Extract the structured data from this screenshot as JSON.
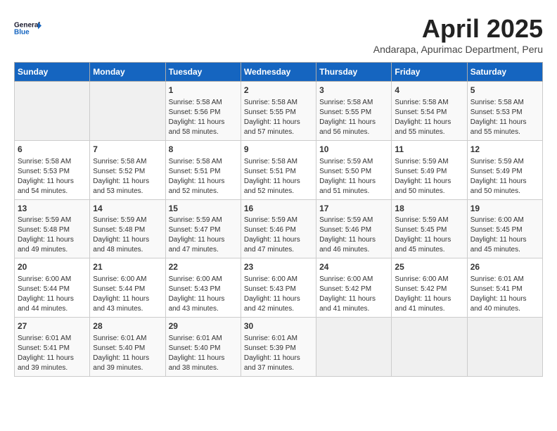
{
  "header": {
    "logo_general": "General",
    "logo_blue": "Blue",
    "month": "April 2025",
    "location": "Andarapa, Apurimac Department, Peru"
  },
  "columns": [
    "Sunday",
    "Monday",
    "Tuesday",
    "Wednesday",
    "Thursday",
    "Friday",
    "Saturday"
  ],
  "weeks": [
    [
      {
        "day": "",
        "info": ""
      },
      {
        "day": "",
        "info": ""
      },
      {
        "day": "1",
        "info": "Sunrise: 5:58 AM\nSunset: 5:56 PM\nDaylight: 11 hours and 58 minutes."
      },
      {
        "day": "2",
        "info": "Sunrise: 5:58 AM\nSunset: 5:55 PM\nDaylight: 11 hours and 57 minutes."
      },
      {
        "day": "3",
        "info": "Sunrise: 5:58 AM\nSunset: 5:55 PM\nDaylight: 11 hours and 56 minutes."
      },
      {
        "day": "4",
        "info": "Sunrise: 5:58 AM\nSunset: 5:54 PM\nDaylight: 11 hours and 55 minutes."
      },
      {
        "day": "5",
        "info": "Sunrise: 5:58 AM\nSunset: 5:53 PM\nDaylight: 11 hours and 55 minutes."
      }
    ],
    [
      {
        "day": "6",
        "info": "Sunrise: 5:58 AM\nSunset: 5:53 PM\nDaylight: 11 hours and 54 minutes."
      },
      {
        "day": "7",
        "info": "Sunrise: 5:58 AM\nSunset: 5:52 PM\nDaylight: 11 hours and 53 minutes."
      },
      {
        "day": "8",
        "info": "Sunrise: 5:58 AM\nSunset: 5:51 PM\nDaylight: 11 hours and 52 minutes."
      },
      {
        "day": "9",
        "info": "Sunrise: 5:58 AM\nSunset: 5:51 PM\nDaylight: 11 hours and 52 minutes."
      },
      {
        "day": "10",
        "info": "Sunrise: 5:59 AM\nSunset: 5:50 PM\nDaylight: 11 hours and 51 minutes."
      },
      {
        "day": "11",
        "info": "Sunrise: 5:59 AM\nSunset: 5:49 PM\nDaylight: 11 hours and 50 minutes."
      },
      {
        "day": "12",
        "info": "Sunrise: 5:59 AM\nSunset: 5:49 PM\nDaylight: 11 hours and 50 minutes."
      }
    ],
    [
      {
        "day": "13",
        "info": "Sunrise: 5:59 AM\nSunset: 5:48 PM\nDaylight: 11 hours and 49 minutes."
      },
      {
        "day": "14",
        "info": "Sunrise: 5:59 AM\nSunset: 5:48 PM\nDaylight: 11 hours and 48 minutes."
      },
      {
        "day": "15",
        "info": "Sunrise: 5:59 AM\nSunset: 5:47 PM\nDaylight: 11 hours and 47 minutes."
      },
      {
        "day": "16",
        "info": "Sunrise: 5:59 AM\nSunset: 5:46 PM\nDaylight: 11 hours and 47 minutes."
      },
      {
        "day": "17",
        "info": "Sunrise: 5:59 AM\nSunset: 5:46 PM\nDaylight: 11 hours and 46 minutes."
      },
      {
        "day": "18",
        "info": "Sunrise: 5:59 AM\nSunset: 5:45 PM\nDaylight: 11 hours and 45 minutes."
      },
      {
        "day": "19",
        "info": "Sunrise: 6:00 AM\nSunset: 5:45 PM\nDaylight: 11 hours and 45 minutes."
      }
    ],
    [
      {
        "day": "20",
        "info": "Sunrise: 6:00 AM\nSunset: 5:44 PM\nDaylight: 11 hours and 44 minutes."
      },
      {
        "day": "21",
        "info": "Sunrise: 6:00 AM\nSunset: 5:44 PM\nDaylight: 11 hours and 43 minutes."
      },
      {
        "day": "22",
        "info": "Sunrise: 6:00 AM\nSunset: 5:43 PM\nDaylight: 11 hours and 43 minutes."
      },
      {
        "day": "23",
        "info": "Sunrise: 6:00 AM\nSunset: 5:43 PM\nDaylight: 11 hours and 42 minutes."
      },
      {
        "day": "24",
        "info": "Sunrise: 6:00 AM\nSunset: 5:42 PM\nDaylight: 11 hours and 41 minutes."
      },
      {
        "day": "25",
        "info": "Sunrise: 6:00 AM\nSunset: 5:42 PM\nDaylight: 11 hours and 41 minutes."
      },
      {
        "day": "26",
        "info": "Sunrise: 6:01 AM\nSunset: 5:41 PM\nDaylight: 11 hours and 40 minutes."
      }
    ],
    [
      {
        "day": "27",
        "info": "Sunrise: 6:01 AM\nSunset: 5:41 PM\nDaylight: 11 hours and 39 minutes."
      },
      {
        "day": "28",
        "info": "Sunrise: 6:01 AM\nSunset: 5:40 PM\nDaylight: 11 hours and 39 minutes."
      },
      {
        "day": "29",
        "info": "Sunrise: 6:01 AM\nSunset: 5:40 PM\nDaylight: 11 hours and 38 minutes."
      },
      {
        "day": "30",
        "info": "Sunrise: 6:01 AM\nSunset: 5:39 PM\nDaylight: 11 hours and 37 minutes."
      },
      {
        "day": "",
        "info": ""
      },
      {
        "day": "",
        "info": ""
      },
      {
        "day": "",
        "info": ""
      }
    ]
  ]
}
